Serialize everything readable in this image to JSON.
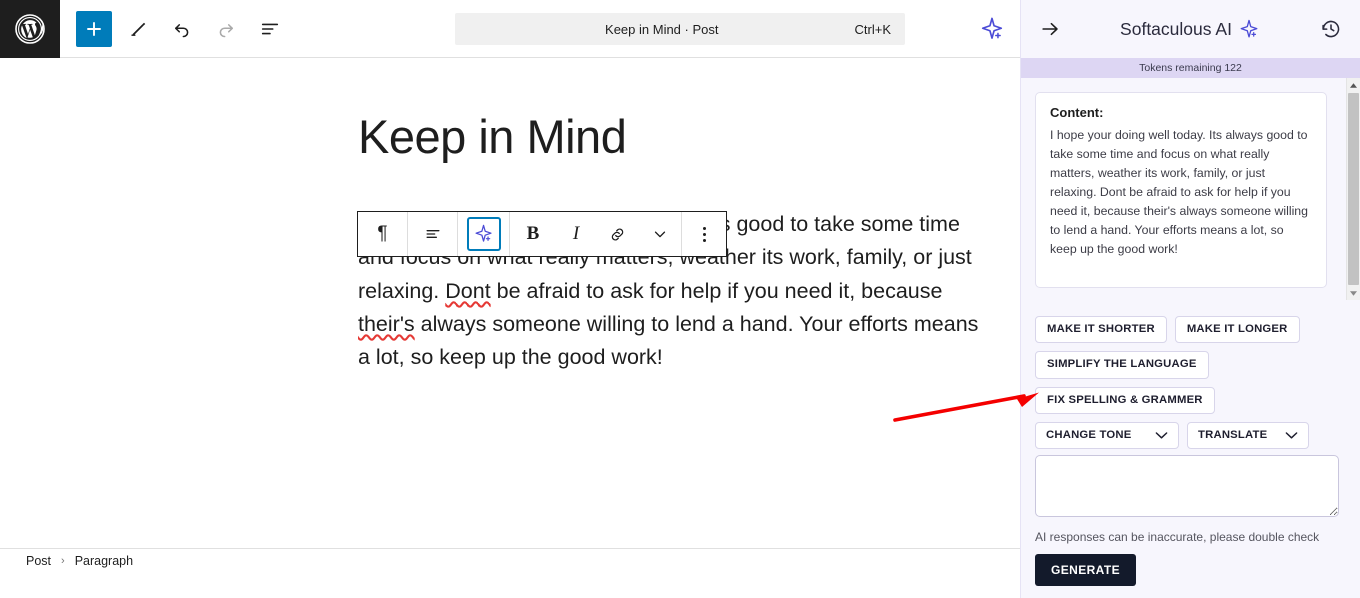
{
  "editor": {
    "logo_icon": "wordpress-logo-icon",
    "toolbar": [
      {
        "name": "add-block-button",
        "icon": "plus-icon"
      },
      {
        "name": "edit-tool-button",
        "icon": "pencil-icon"
      },
      {
        "name": "undo-button",
        "icon": "undo-arrow-icon"
      },
      {
        "name": "redo-button",
        "icon": "redo-arrow-icon"
      },
      {
        "name": "document-overview-button",
        "icon": "list-view-icon"
      }
    ],
    "command_bar": {
      "title": "Keep in Mind · Post",
      "shortcut": "Ctrl+K"
    },
    "post": {
      "title": "Keep in Mind",
      "body_part1": "I hope your doing well today. Its always good to take some time and focus on what really matters, weather its work, family, or just relaxing. ",
      "body_misspelled1": "Dont",
      "body_part2": " be afraid to ask for help if you need it, because ",
      "body_misspelled2": "their's",
      "body_part3": " always someone willing to lend a hand. Your efforts means a lot, so keep up the good work!"
    },
    "block_toolbar": {
      "paragraph_glyph": "¶",
      "bold_label": "B",
      "italic_label": "I",
      "items": [
        "paragraph-type",
        "align-text",
        "ai-assist",
        "bold",
        "italic",
        "link",
        "more-formatting",
        "options"
      ]
    },
    "breadcrumb": {
      "root": "Post",
      "separator": "›",
      "current": "Paragraph"
    }
  },
  "ai_panel": {
    "title": "Softaculous AI",
    "collapse_icon": "arrow-right-icon",
    "history_icon": "history-clock-icon",
    "tokens_text": "Tokens remaining 122",
    "content": {
      "label": "Content:",
      "text": "I hope your doing well today. Its always good to take some time and focus on what really matters, weather its work, family, or just relaxing. Dont be afraid to ask for help if you need it, because their's always someone willing to lend a hand. Your efforts means a lot, so keep up the good work!"
    },
    "actions": {
      "make_shorter": "MAKE IT SHORTER",
      "make_longer": "MAKE IT LONGER",
      "simplify": "SIMPLIFY THE LANGUAGE",
      "fix_spelling": "FIX SPELLING & GRAMMER",
      "change_tone": "CHANGE TONE",
      "translate": "TRANSLATE"
    },
    "prompt_value": "",
    "prompt_placeholder": "",
    "disclaimer": "AI responses can be inaccurate, please double check",
    "generate_label": "GENERATE"
  },
  "annotation": {
    "arrow_color": "#f40000",
    "points_to": "FIX SPELLING & GRAMMER"
  },
  "colors": {
    "wp_blue": "#007cba",
    "panel_bg": "#f7f6fd",
    "tokens_bg": "#ddd6f3",
    "sparkle": "#4b4bd6",
    "generate_bg": "#131a2b",
    "spellcheck_underline": "#e53935"
  }
}
